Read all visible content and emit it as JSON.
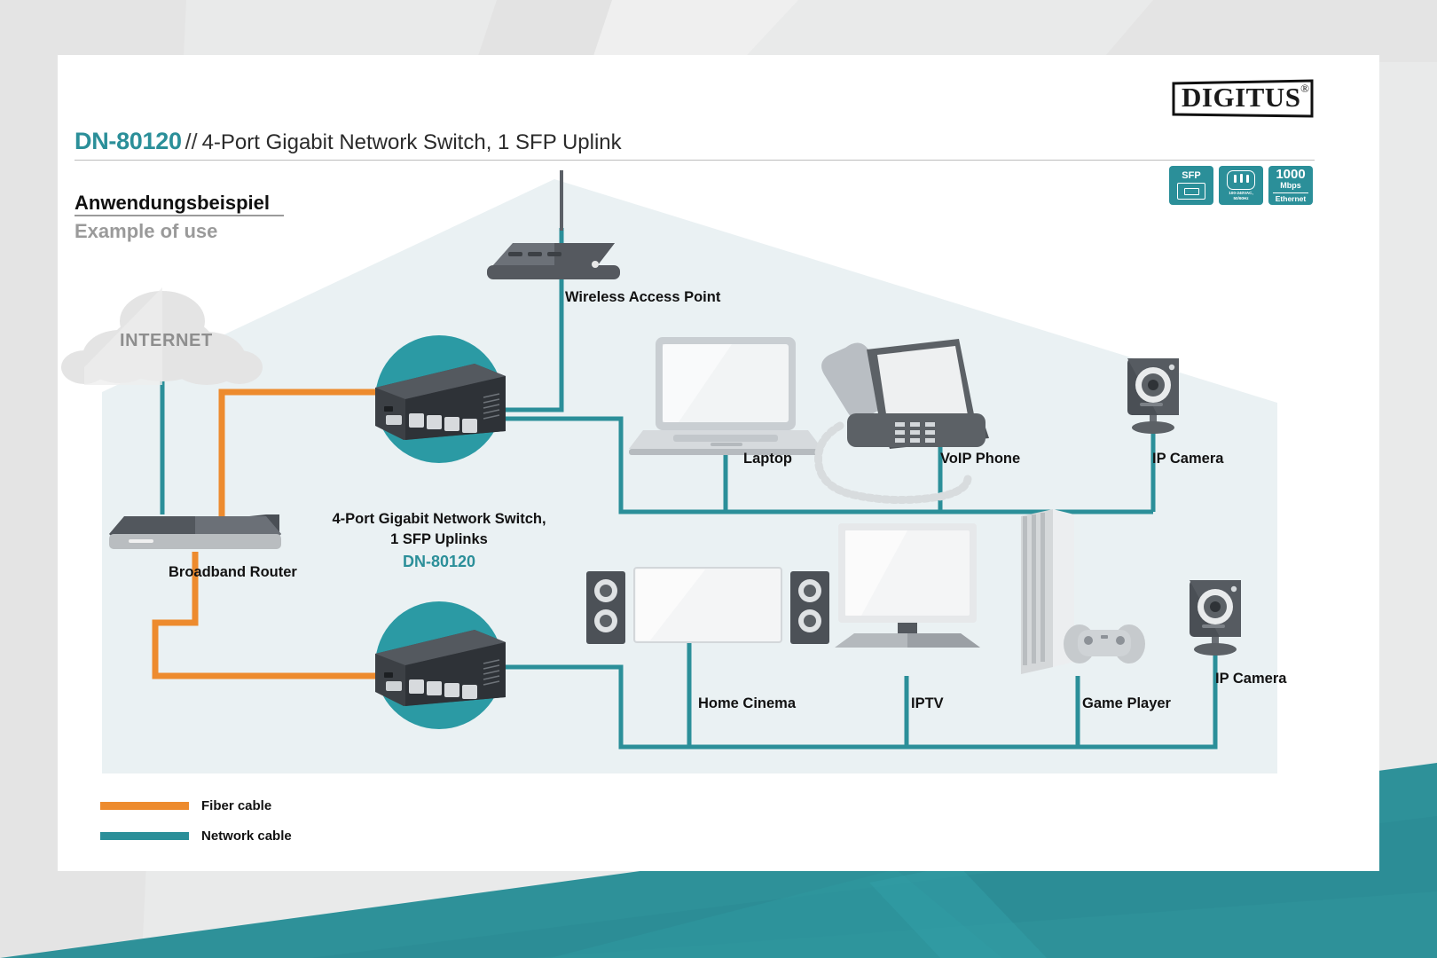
{
  "page": {
    "background_color": "#e9eaea",
    "card_color": "#ffffff",
    "accent_teal": "#2b8f99",
    "accent_orange": "#ed8b2e",
    "house_fill": "#eaf1f3",
    "circle_fill": "#2b9aa4"
  },
  "header": {
    "logo_text": "DIGITUS",
    "logo_registered": "®",
    "model": "DN-80120",
    "separator": "//",
    "description": "4-Port Gigabit Network Switch, 1 SFP Uplink"
  },
  "badges": [
    {
      "name": "sfp-badge",
      "line1": "SFP",
      "line2": "",
      "line3": ""
    },
    {
      "name": "power-badge",
      "line1": "",
      "line2": "100-240VAC,",
      "line3": "50/60Hz"
    },
    {
      "name": "ethernet-badge",
      "line1": "1000",
      "line2": "Mbps",
      "line3": "Ethernet"
    }
  ],
  "section": {
    "heading_de": "Anwendungsbeispiel",
    "heading_en": "Example of use"
  },
  "nodes": {
    "internet": "INTERNET",
    "broadband_router": "Broadband Router",
    "wireless_access_point": "Wireless Access Point",
    "switch_line1": "4-Port Gigabit Network Switch,",
    "switch_line2": "1 SFP Uplinks",
    "switch_model": "DN-80120",
    "laptop": "Laptop",
    "voip_phone": "VoIP Phone",
    "ip_camera_top": "IP Camera",
    "home_cinema": "Home Cinema",
    "iptv": "IPTV",
    "game_player": "Game Player",
    "ip_camera_bottom": "IP Camera"
  },
  "legend": {
    "items": [
      {
        "label": "Fiber cable",
        "color": "#ed8b2e"
      },
      {
        "label": "Network cable",
        "color": "#2b8f99"
      }
    ]
  }
}
